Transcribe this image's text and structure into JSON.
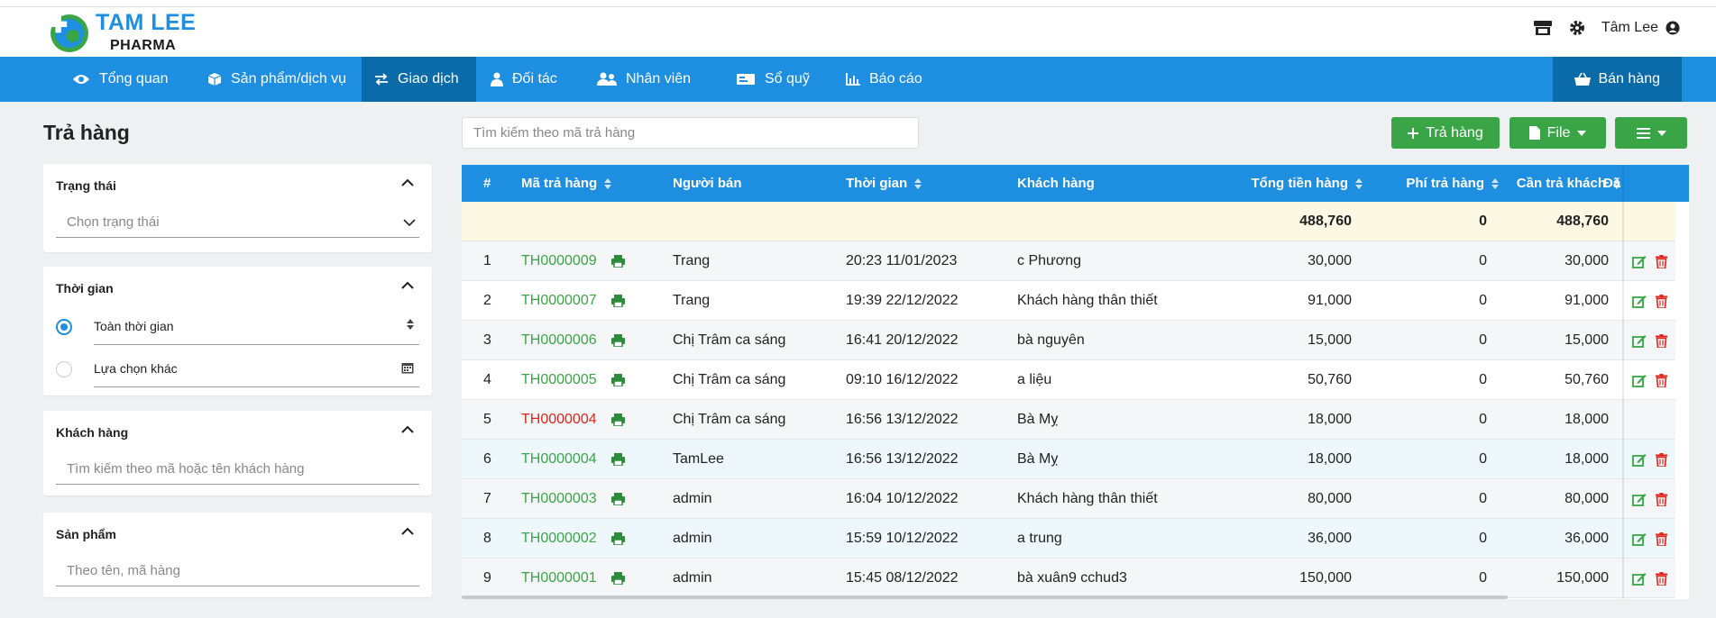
{
  "brand": {
    "name": "TAM LEE",
    "sub": "PHARMA"
  },
  "header": {
    "user_name": "Tâm Lee"
  },
  "nav": {
    "items": [
      {
        "label": "Tổng quan",
        "icon": "eye-icon"
      },
      {
        "label": "Sản phẩm/dịch vụ",
        "icon": "box-icon"
      },
      {
        "label": "Giao dịch",
        "icon": "exchange-icon",
        "active": true
      },
      {
        "label": "Đối tác",
        "icon": "user-tie-icon"
      },
      {
        "label": "Nhân viên",
        "icon": "users-icon"
      },
      {
        "label": "Sổ quỹ",
        "icon": "money-icon"
      },
      {
        "label": "Báo cáo",
        "icon": "chart-icon"
      }
    ],
    "sell_label": "Bán hàng"
  },
  "page": {
    "title": "Trả hàng"
  },
  "filters": {
    "status": {
      "title": "Trạng thái",
      "placeholder": "Chọn trạng thái"
    },
    "time": {
      "title": "Thời gian",
      "option_all": "Toàn thời gian",
      "option_custom": "Lựa chọn khác"
    },
    "customer": {
      "title": "Khách hàng",
      "placeholder": "Tìm kiếm theo mã hoặc tên khách hàng"
    },
    "product": {
      "title": "Sản phẩm",
      "placeholder": "Theo tên, mã hàng"
    }
  },
  "toolbar": {
    "search_placeholder": "Tìm kiếm theo mã trả hàng",
    "return_label": "Trả hàng",
    "file_label": "File"
  },
  "table": {
    "columns": {
      "index": "#",
      "code": "Mã trả hàng",
      "seller": "Người bán",
      "time": "Thời gian",
      "customer": "Khách hàng",
      "total": "Tổng tiền hàng",
      "fee": "Phí trả hàng",
      "refund": "Cần trả khách",
      "paid": "Đã"
    },
    "summary": {
      "total": "488,760",
      "fee": "0",
      "refund": "488,760"
    },
    "rows": [
      {
        "index": "1",
        "code": "TH0000009",
        "seller": "Trang",
        "time": "20:23 11/01/2023",
        "customer": "c Phương",
        "total": "30,000",
        "fee": "0",
        "refund": "30,000"
      },
      {
        "index": "2",
        "code": "TH0000007",
        "seller": "Trang",
        "time": "19:39 22/12/2022",
        "customer": "Khách hàng thân thiết",
        "total": "91,000",
        "fee": "0",
        "refund": "91,000"
      },
      {
        "index": "3",
        "code": "TH0000006",
        "seller": "Chị Trâm ca sáng",
        "time": "16:41 20/12/2022",
        "customer": "bà nguyên",
        "total": "15,000",
        "fee": "0",
        "refund": "15,000"
      },
      {
        "index": "4",
        "code": "TH0000005",
        "seller": "Chị Trâm ca sáng",
        "time": "09:10 16/12/2022",
        "customer": "a liệu",
        "total": "50,760",
        "fee": "0",
        "refund": "50,760"
      },
      {
        "index": "5",
        "code": "TH0000004",
        "seller": "Chị Trâm ca sáng",
        "time": "16:56 13/12/2022",
        "customer": "Bà Mỵ",
        "total": "18,000",
        "fee": "0",
        "refund": "18,000"
      },
      {
        "index": "6",
        "code": "TH0000004",
        "seller": "TamLee",
        "time": "16:56 13/12/2022",
        "customer": "Bà Mỵ",
        "total": "18,000",
        "fee": "0",
        "refund": "18,000"
      },
      {
        "index": "7",
        "code": "TH0000003",
        "seller": "admin",
        "time": "16:04 10/12/2022",
        "customer": "Khách hàng thân thiết",
        "total": "80,000",
        "fee": "0",
        "refund": "80,000"
      },
      {
        "index": "8",
        "code": "TH0000002",
        "seller": "admin",
        "time": "15:59 10/12/2022",
        "customer": "a trung",
        "total": "36,000",
        "fee": "0",
        "refund": "36,000"
      },
      {
        "index": "9",
        "code": "TH0000001",
        "seller": "admin",
        "time": "15:45 08/12/2022",
        "customer": "bà xuân9 cchud3",
        "total": "150,000",
        "fee": "0",
        "refund": "150,000"
      }
    ]
  },
  "colors": {
    "primary": "#1e8fe0",
    "primary_dark": "#0b6aa8",
    "green": "#3aa546",
    "red": "#e0251b",
    "summary_bg": "#fcf8e3"
  }
}
